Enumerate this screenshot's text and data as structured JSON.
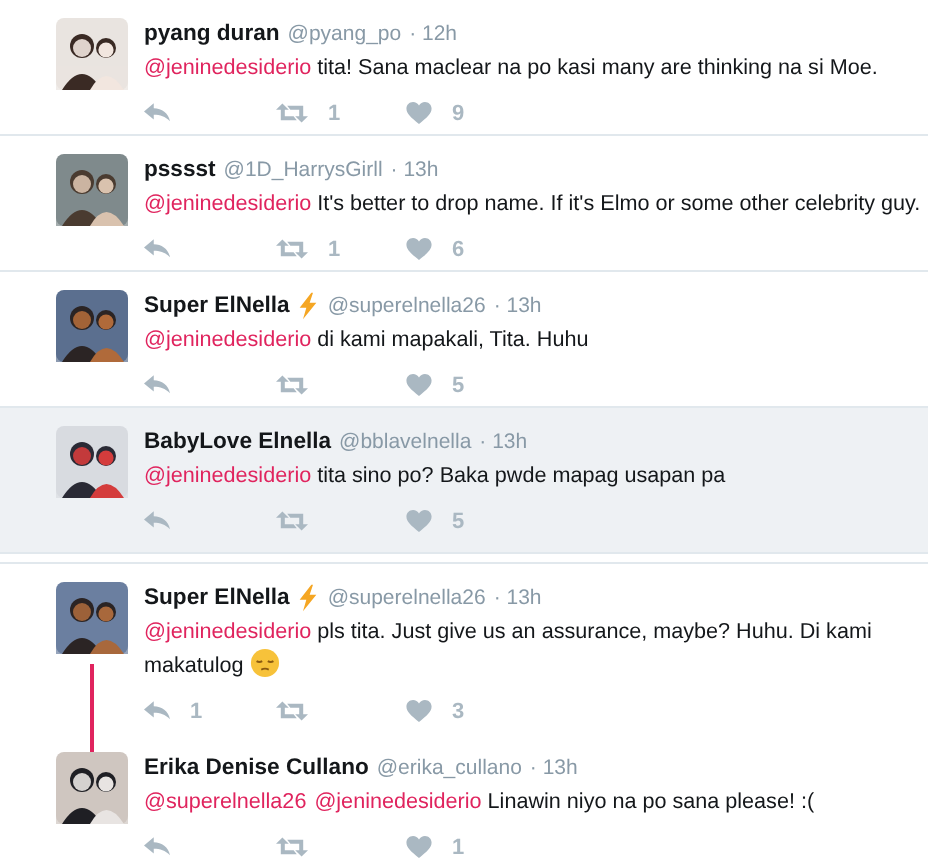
{
  "tweets": [
    {
      "name": "pyang duran",
      "verified_bolt": false,
      "handle": "@pyang_po",
      "time": "· 12h",
      "highlighted": false,
      "avatar": {
        "kind": "picture"
      },
      "segments": [
        {
          "kind": "mention",
          "text": "@jeninedesiderio"
        },
        {
          "kind": "text",
          "text": " tita! Sana maclear na po kasi many are thinking na si Moe."
        }
      ],
      "retweets": "1",
      "likes": "9"
    },
    {
      "name": "psssst",
      "verified_bolt": false,
      "handle": "@1D_HarrysGirll",
      "time": "· 13h",
      "highlighted": false,
      "avatar": {
        "kind": "picture"
      },
      "segments": [
        {
          "kind": "mention",
          "text": "@jeninedesiderio"
        },
        {
          "kind": "text",
          "text": " It's better to drop name. If it's Elmo or some other celebrity guy."
        }
      ],
      "retweets": "1",
      "likes": "6"
    },
    {
      "name": "Super ElNella",
      "verified_bolt": true,
      "handle": "@superelnella26",
      "time": "· 13h",
      "highlighted": false,
      "avatar": {
        "kind": "picture"
      },
      "segments": [
        {
          "kind": "mention",
          "text": "@jeninedesiderio"
        },
        {
          "kind": "text",
          "text": " di kami mapakali, Tita. Huhu"
        }
      ],
      "likes": "5"
    },
    {
      "name": "BabyLove Elnella",
      "verified_bolt": false,
      "handle": "@bblavelnella",
      "time": "· 13h",
      "highlighted": true,
      "avatar": {
        "kind": "picture"
      },
      "segments": [
        {
          "kind": "mention",
          "text": "@jeninedesiderio"
        },
        {
          "kind": "text",
          "text": " tita sino po? Baka pwde mapag usapan pa"
        }
      ],
      "likes": "5"
    }
  ],
  "conversation": {
    "tweets": [
      {
        "name": "Super ElNella",
        "verified_bolt": true,
        "handle": "@superelnella26",
        "time": "· 13h",
        "avatar": {
          "kind": "picture"
        },
        "segments": [
          {
            "kind": "mention",
            "text": "@jeninedesiderio"
          },
          {
            "kind": "text",
            "text": " pls tita. Just give us an assurance, maybe? Huhu. Di kami makatulog "
          },
          {
            "kind": "emoji"
          }
        ],
        "replies": "1",
        "likes": "3"
      },
      {
        "name": "Erika Denise Cullano",
        "verified_bolt": false,
        "handle": "@erika_cullano",
        "time": "· 13h",
        "avatar": {
          "kind": "picture"
        },
        "segments": [
          {
            "kind": "mention",
            "text": "@superelnella26"
          },
          {
            "kind": "mention",
            "text": "@jeninedesiderio"
          },
          {
            "kind": "text",
            "text": " Linawin niyo na po sana please! :("
          }
        ],
        "likes": "1"
      }
    ]
  }
}
